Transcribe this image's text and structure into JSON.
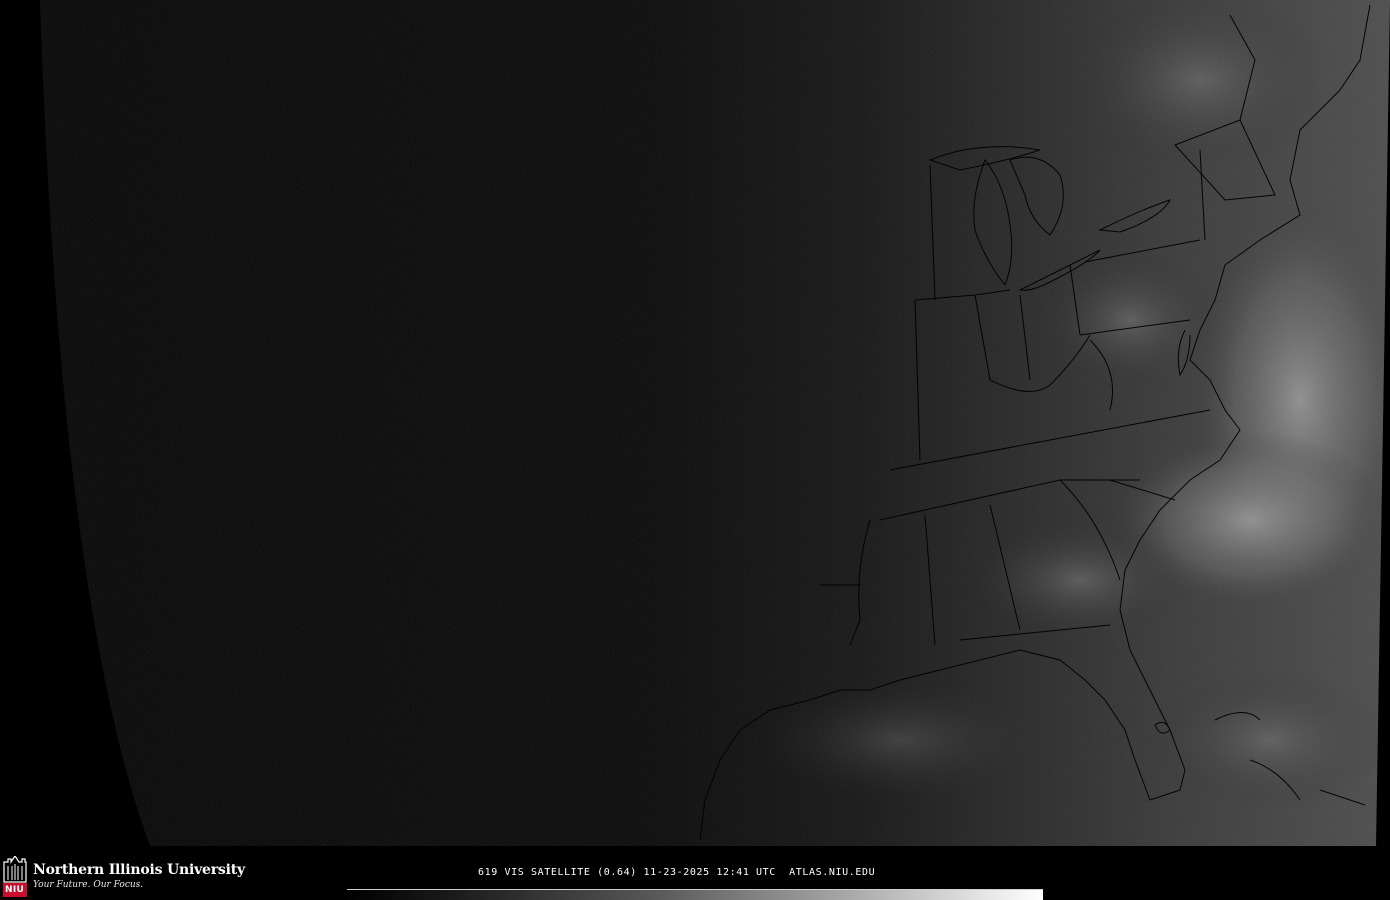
{
  "footer": {
    "org_name": "Northern Illinois University",
    "tagline": "Your Future. Our Focus.",
    "seal_text": "NIU",
    "caption": "619 VIS SATELLITE (0.64) 11-23-2025 12:41 UTC  ATLAS.NIU.EDU"
  },
  "imagery": {
    "channel": "VIS",
    "wavelength": "0.64",
    "date": "11-23-2025",
    "time_utc": "12:41",
    "terminator": "dawn",
    "scale_colors": [
      "#000000",
      "#ffffff"
    ]
  },
  "colors": {
    "background": "#000000",
    "seal_red": "#c8102e",
    "boundary_line": "#000000",
    "caption_text": "#ffffff"
  }
}
